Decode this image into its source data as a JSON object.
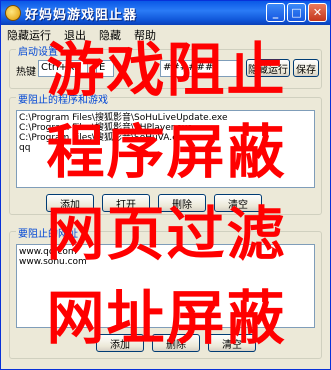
{
  "window": {
    "title": "好妈妈游戏阻止器",
    "minimize_glyph": "_",
    "maximize_glyph": "□",
    "close_glyph": "✕"
  },
  "menu": [
    "隐藏运行",
    "退出",
    "隐藏",
    "帮助"
  ],
  "startup_group": {
    "title": "启动设置",
    "hotkey_label": "热键",
    "hotkey_value": "Ctrl+Alt",
    "hotkey_key": "E",
    "password_value": "######",
    "hide_run_button": "隐藏运行",
    "save_button": "保存"
  },
  "block_programs": {
    "title": "要阻止的程序和游戏",
    "items": [
      "C:\\Program Files\\搜狐影音\\SoHuLiveUpdate.exe",
      "C:\\Program Files\\搜狐影音\\SHPlayer.exe",
      "C:\\Program Files\\搜狐影音\\SoHuVA.exe",
      "qq"
    ],
    "buttons": [
      "添加",
      "打开",
      "删除",
      "清空"
    ]
  },
  "block_sites": {
    "title": "要阻止的网址",
    "items": [
      "www.qq.com",
      "www.sohu.com"
    ],
    "buttons": [
      "添加",
      "删除",
      "清空"
    ]
  },
  "overlay_lines": [
    "游戏阻止",
    "程序屏蔽",
    "网页过滤",
    "网址屏蔽"
  ]
}
